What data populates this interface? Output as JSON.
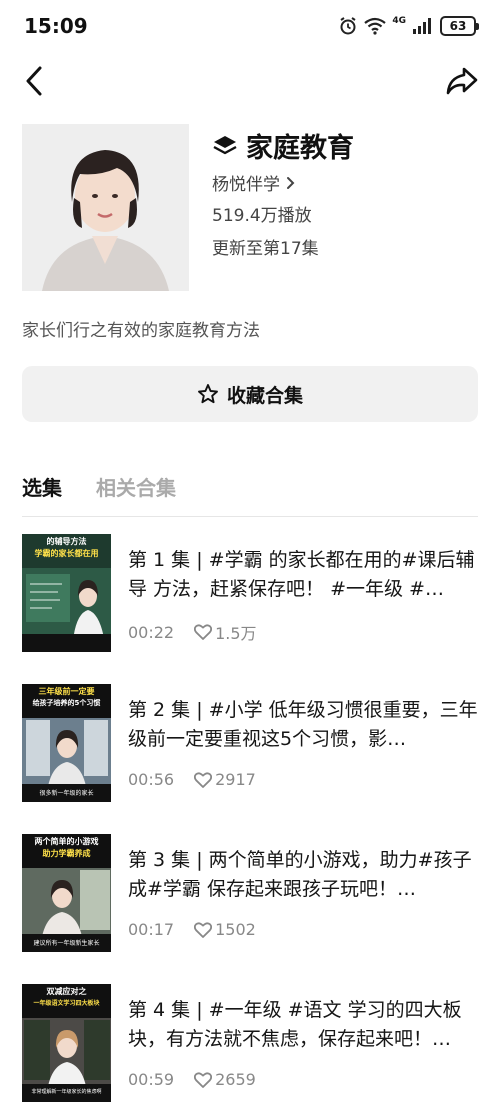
{
  "status": {
    "time": "15:09",
    "network": "4G",
    "battery": "63"
  },
  "series": {
    "title": "家庭教育",
    "author": "杨悦伴学",
    "plays": "519.4万播放",
    "update": "更新至第17集",
    "description": "家长们行之有效的家庭教育方法"
  },
  "collect_button": {
    "label": "收藏合集"
  },
  "tabs": [
    {
      "label": "选集",
      "active": true
    },
    {
      "label": "相关合集",
      "active": false
    }
  ],
  "episodes": [
    {
      "title": "第 1 集 | #学霸 的家长都在用的#课后辅导 方法，赶紧保存吧！ #一年级 #…",
      "duration": "00:22",
      "likes": "1.5万",
      "thumb_top": "的辅导方法",
      "thumb_sub": "学霸的家长都在用",
      "thumb_bottom": ""
    },
    {
      "title": "第 2 集 | #小学 低年级习惯很重要，三年级前一定要重视这5个习惯，影…",
      "duration": "00:56",
      "likes": "2917",
      "thumb_top": "三年级前一定要",
      "thumb_sub": "给孩子培养的5个习惯",
      "thumb_bottom": "很多新一年级的家长"
    },
    {
      "title": "第 3 集 | 两个简单的小游戏，助力#孩子 成#学霸 保存起来跟孩子玩吧！…",
      "duration": "00:17",
      "likes": "1502",
      "thumb_top": "两个简单的小游戏",
      "thumb_sub": "助力学霸养成",
      "thumb_bottom": "建议所有一年级新生家长"
    },
    {
      "title": "第 4 集 | #一年级 #语文 学习的四大板块，有方法就不焦虑，保存起来吧！…",
      "duration": "00:59",
      "likes": "2659",
      "thumb_top": "双减应对之",
      "thumb_sub": "一年级语文学习四大板块",
      "thumb_bottom": "非常理解新一年级家长的焦虑啊"
    }
  ]
}
